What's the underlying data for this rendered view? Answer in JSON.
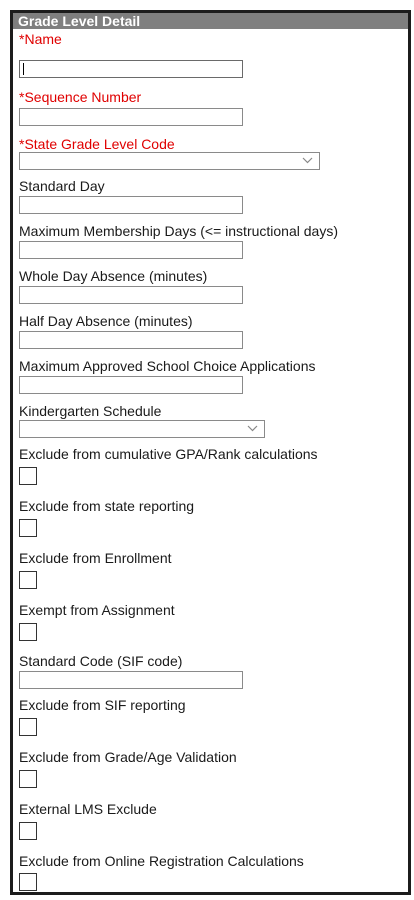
{
  "panel": {
    "title": "Grade Level Detail",
    "fields": {
      "name": {
        "label": "Name",
        "required_marker": "*",
        "value": ""
      },
      "sequence_number": {
        "label": "Sequence Number",
        "required_marker": "*",
        "value": ""
      },
      "state_grade_level_code": {
        "label": "State Grade Level Code",
        "required_marker": "*",
        "selected": ""
      },
      "standard_day": {
        "label": "Standard Day",
        "value": ""
      },
      "max_membership_days": {
        "label": "Maximum Membership Days (<= instructional days)",
        "value": ""
      },
      "whole_day_absence": {
        "label": "Whole Day Absence (minutes)",
        "value": ""
      },
      "half_day_absence": {
        "label": "Half Day Absence (minutes)",
        "value": ""
      },
      "max_school_choice_apps": {
        "label": "Maximum Approved School Choice Applications",
        "value": ""
      },
      "kindergarten_schedule": {
        "label": "Kindergarten Schedule",
        "selected": ""
      },
      "exclude_gpa_rank": {
        "label": "Exclude from cumulative GPA/Rank calculations",
        "checked": false
      },
      "exclude_state_reporting": {
        "label": "Exclude from state reporting",
        "checked": false
      },
      "exclude_enrollment": {
        "label": "Exclude from Enrollment",
        "checked": false
      },
      "exempt_assignment": {
        "label": "Exempt from Assignment",
        "checked": false
      },
      "standard_code_sif": {
        "label": "Standard Code (SIF code)",
        "value": ""
      },
      "exclude_sif_reporting": {
        "label": "Exclude from SIF reporting",
        "checked": false
      },
      "exclude_grade_age_validation": {
        "label": "Exclude from Grade/Age Validation",
        "checked": false
      },
      "external_lms_exclude": {
        "label": "External LMS Exclude",
        "checked": false
      },
      "exclude_online_registration": {
        "label": "Exclude from Online Registration Calculations",
        "checked": false
      }
    }
  },
  "colors": {
    "required": "#e00000",
    "header_bg": "#7f7f7f",
    "border": "#1c1c1c"
  }
}
